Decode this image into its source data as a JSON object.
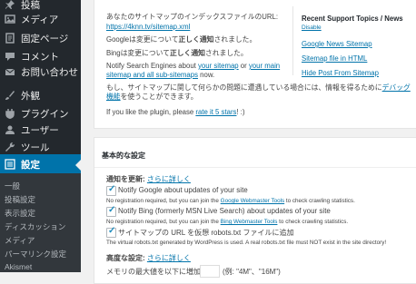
{
  "sidebar": {
    "items": [
      {
        "label": "投稿",
        "icon": "pin-icon"
      },
      {
        "label": "メディア",
        "icon": "media-icon"
      },
      {
        "label": "固定ページ",
        "icon": "page-icon"
      },
      {
        "label": "コメント",
        "icon": "comment-icon"
      },
      {
        "label": "お問い合わせ",
        "icon": "mail-icon"
      },
      {
        "label": "外観",
        "icon": "brush-icon"
      },
      {
        "label": "プラグイン",
        "icon": "plugin-icon"
      },
      {
        "label": "ユーザー",
        "icon": "user-icon"
      },
      {
        "label": "ツール",
        "icon": "wrench-icon"
      },
      {
        "label": "設定",
        "icon": "settings-icon"
      }
    ],
    "submenu": [
      "一般",
      "投稿設定",
      "表示設定",
      "ディスカッション",
      "メディア",
      "パーマリンク設定",
      "Akismet"
    ]
  },
  "panel1": {
    "sitemap_intro": "あなたのサイトマップのインデックスファイルのURL:",
    "sitemap_url": "https://4knn.tv/sitemap.xml",
    "google_prefix": "Googleは変更について",
    "google_bold": "正しく通知",
    "google_suffix": "されました。",
    "bing_prefix": "Bingは変更について",
    "bing_bold": "正しく通知",
    "bing_suffix": "されました。",
    "notify_prefix": "Notify Search Engines about ",
    "notify_link1": "your sitemap",
    "notify_or": " or ",
    "notify_link2": "your main sitemap and all sub-sitemaps",
    "notify_suffix": " now.",
    "problem_text": "もし、サイトマップに関して何らかの問題に遭遇している場合には、情報を得るために",
    "debug_link": "デバッグ機能",
    "problem_suffix": "を使うことができます。",
    "rate_prefix": "If you like the plugin, please ",
    "rate_link": "rate it 5 stars",
    "rate_suffix": "! :)",
    "topics_heading": "Recent Support Topics / News",
    "topics_disable": "Disable",
    "topics": [
      "Google News Sitemap",
      "Sitemap file in HTML",
      "Hide Post From Sitemap"
    ]
  },
  "panel2": {
    "title": "基本的な設定",
    "update_label": "通知を更新: ",
    "update_link": "さらに詳しく",
    "options": [
      {
        "checked": true,
        "label": "Notify Google about updates of your site",
        "note_prefix": "No registration required, but you can join the ",
        "note_link": "Google Webmaster Tools",
        "note_suffix": " to check crawling statistics."
      },
      {
        "checked": true,
        "label": "Notify Bing (formerly MSN Live Search) about updates of your site",
        "note_prefix": "No registration required, but you can join the ",
        "note_link": "Bing Webmaster Tools",
        "note_suffix": " to check crawling statistics."
      },
      {
        "checked": true,
        "label": "サイトマップの URL を仮想 robots.txt ファイルに追加",
        "note_prefix": "The virtual robots.txt generated by WordPress is used. A real robots.txt file must NOT exist in the site directory!",
        "note_link": "",
        "note_suffix": ""
      }
    ],
    "advanced_label": "高度な設定: ",
    "advanced_link": "さらに詳しく",
    "memory_label": "メモリの最大値を以下に増加:",
    "memory_hint": "(例: \"4M\"、\"16M\")"
  }
}
